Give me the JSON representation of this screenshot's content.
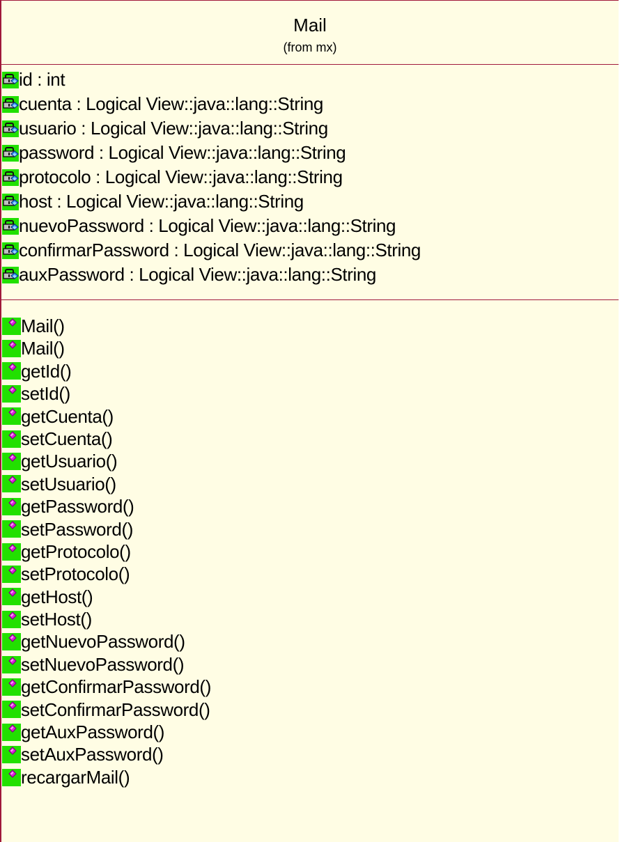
{
  "class": {
    "name": "Mail",
    "stereotype": "(from mx)"
  },
  "icons": {
    "attribute": "private-attribute-lock-icon",
    "operation": "public-operation-icon"
  },
  "colors": {
    "border": "#a0183a",
    "background": "#fffde4",
    "attribute_icon": "#22e000",
    "operation_icon_bg": "#22e000",
    "operation_icon_diamond": "#e020e0"
  },
  "attributes": [
    "id : int",
    "cuenta : Logical View::java::lang::String",
    "usuario : Logical View::java::lang::String",
    "password : Logical View::java::lang::String",
    "protocolo : Logical View::java::lang::String",
    "host : Logical View::java::lang::String",
    "nuevoPassword : Logical View::java::lang::String",
    "confirmarPassword : Logical View::java::lang::String",
    "auxPassword : Logical View::java::lang::String"
  ],
  "operations": [
    "Mail()",
    "Mail()",
    "getId()",
    "setId()",
    "getCuenta()",
    "setCuenta()",
    "getUsuario()",
    "setUsuario()",
    "getPassword()",
    "setPassword()",
    "getProtocolo()",
    "setProtocolo()",
    "getHost()",
    "setHost()",
    "getNuevoPassword()",
    "setNuevoPassword()",
    "getConfirmarPassword()",
    "setConfirmarPassword()",
    "getAuxPassword()",
    "setAuxPassword()",
    "recargarMail()"
  ]
}
